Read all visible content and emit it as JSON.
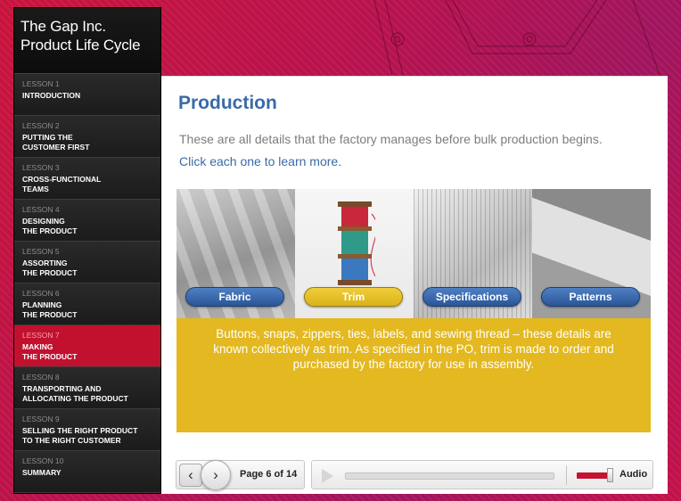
{
  "app": {
    "title_line1": "The Gap Inc.",
    "title_line2": "Product Life Cycle"
  },
  "lessons": [
    {
      "num": "LESSON 1",
      "title": "INTRODUCTION",
      "active": false
    },
    {
      "num": "LESSON 2",
      "title": "PUTTING THE\nCUSTOMER FIRST",
      "active": false
    },
    {
      "num": "LESSON 3",
      "title": "CROSS-FUNCTIONAL\nTEAMS",
      "active": false
    },
    {
      "num": "LESSON 4",
      "title": "DESIGNING\nTHE PRODUCT",
      "active": false
    },
    {
      "num": "LESSON 5",
      "title": "ASSORTING\nTHE PRODUCT",
      "active": false
    },
    {
      "num": "LESSON 6",
      "title": "PLANNING\nTHE PRODUCT",
      "active": false
    },
    {
      "num": "LESSON 7",
      "title": "MAKING\nTHE PRODUCT",
      "active": true
    },
    {
      "num": "LESSON 8",
      "title": "TRANSPORTING AND\nALLOCATING THE PRODUCT",
      "active": false
    },
    {
      "num": "LESSON 9",
      "title": "SELLING THE RIGHT PRODUCT\nTO THE RIGHT CUSTOMER",
      "active": false
    },
    {
      "num": "LESSON 10",
      "title": "SUMMARY",
      "active": false
    }
  ],
  "content": {
    "title": "Production",
    "intro": "These are all details that the factory manages before bulk production begins.",
    "hint": "Click each one to learn more.",
    "tiles": [
      {
        "label": "Fabric",
        "selected": false
      },
      {
        "label": "Trim",
        "selected": true
      },
      {
        "label": "Specifications",
        "selected": false
      },
      {
        "label": "Patterns",
        "selected": false
      }
    ],
    "description": "Buttons, snaps, zippers, ties, labels, and sewing thread – these details are known collectively as trim. As specified in the PO, trim is made to order and purchased by the factory for use in assembly."
  },
  "player": {
    "page_label": "Page 6 of 14",
    "audio_label": "Audio",
    "audio_progress": 0.0,
    "volume": 0.9
  },
  "colors": {
    "accent_red": "#c1112f",
    "title_blue": "#3a6aa8",
    "trim_yellow": "#e3b820",
    "pill_blue": "#2a5696"
  },
  "icons": {
    "prev": "chevron-left-icon",
    "next": "chevron-right-icon",
    "play": "play-icon"
  }
}
